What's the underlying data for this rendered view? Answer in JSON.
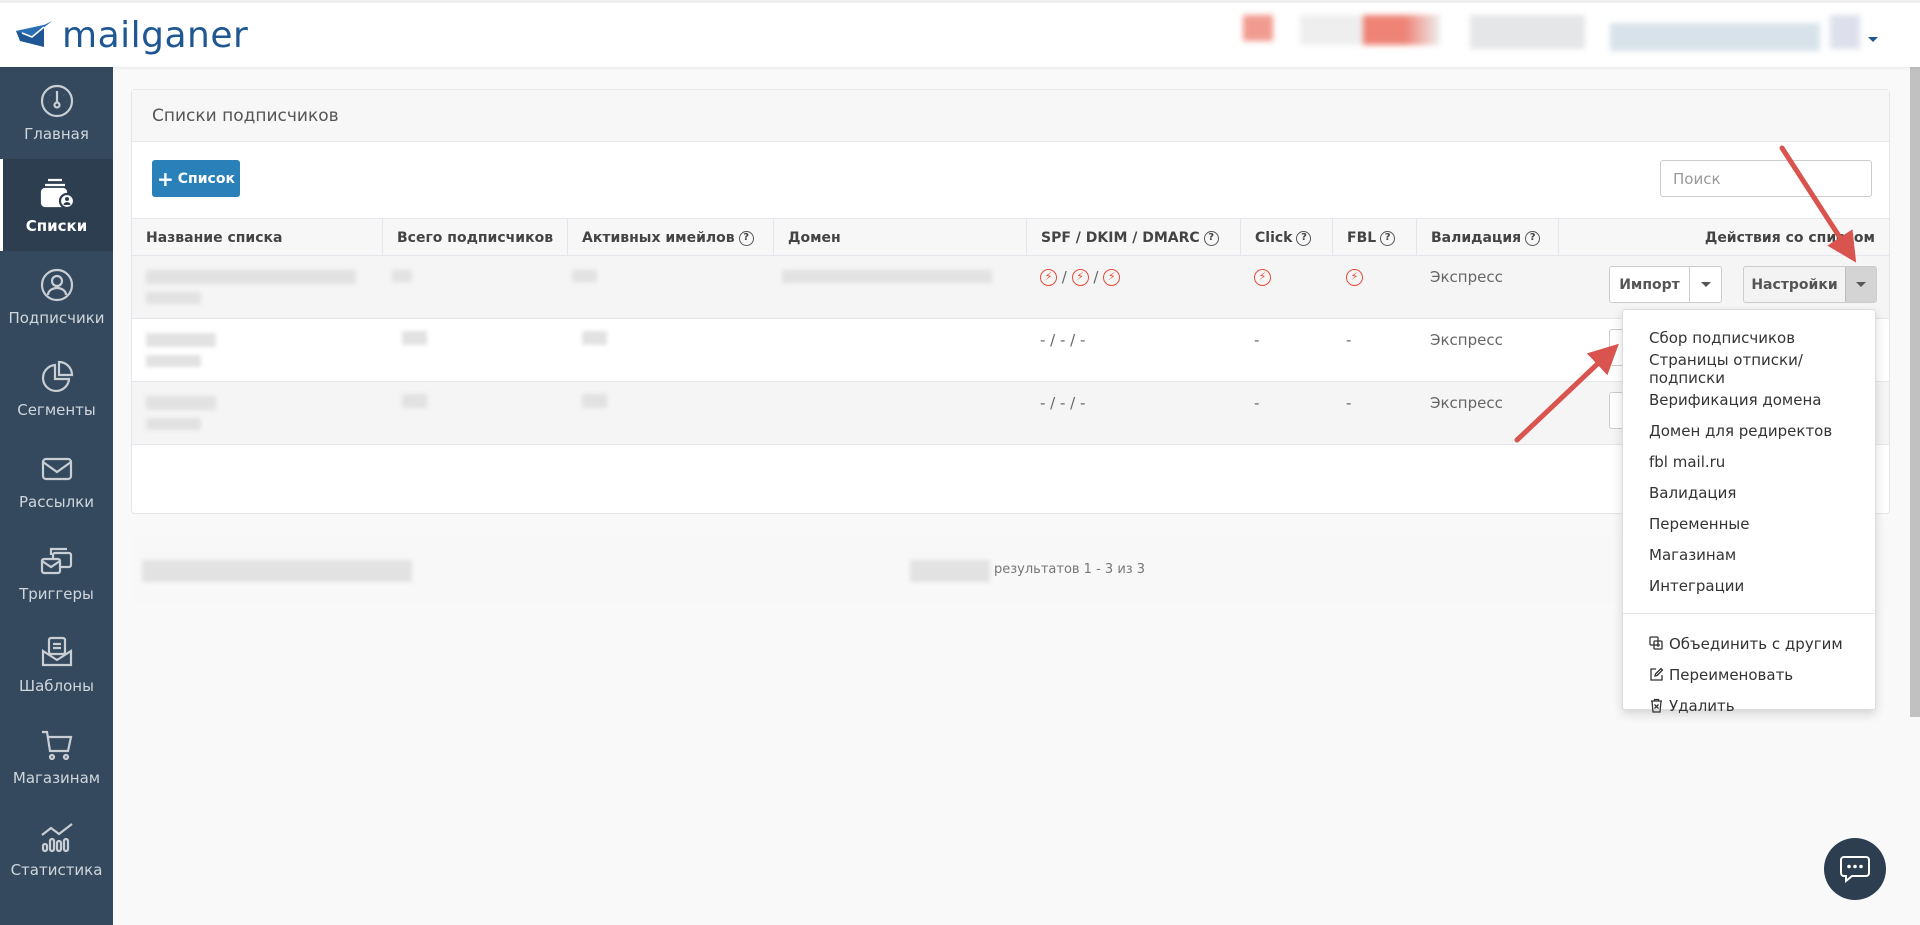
{
  "app": {
    "logo_text": "mailganer"
  },
  "sidebar": {
    "items": [
      {
        "label": "Главная",
        "icon": "dashboard-gauge-icon"
      },
      {
        "label": "Списки",
        "icon": "lists-icon",
        "active": true
      },
      {
        "label": "Подписчики",
        "icon": "user-circle-icon"
      },
      {
        "label": "Сегменты",
        "icon": "pie-chart-icon"
      },
      {
        "label": "Рассылки",
        "icon": "envelope-icon"
      },
      {
        "label": "Триггеры",
        "icon": "trigger-envelopes-icon"
      },
      {
        "label": "Шаблоны",
        "icon": "template-icon"
      },
      {
        "label": "Магазинам",
        "icon": "cart-icon"
      },
      {
        "label": "Статистика",
        "icon": "statistics-icon"
      }
    ]
  },
  "panel": {
    "title": "Списки подписчиков",
    "add_button": "Список",
    "search_placeholder": "Поиск",
    "columns": [
      "Название списка",
      "Всего подписчиков",
      "Активных имейлов",
      "Домен",
      "SPF / DKIM / DMARC",
      "Click",
      "FBL",
      "Валидация",
      "Действия со списком"
    ],
    "rows": [
      {
        "spf": "error",
        "click": "error",
        "fbl": "error",
        "validation": "Экспресс"
      },
      {
        "spf": "- / - / -",
        "click": "-",
        "fbl": "-",
        "validation": "Экспресс"
      },
      {
        "spf": "- / - / -",
        "click": "-",
        "fbl": "-",
        "validation": "Экспресс"
      }
    ],
    "import_button": "Импорт",
    "settings_button": "Настройки",
    "pagination": "результатов 1 - 3 из 3"
  },
  "dropdown": {
    "items": [
      "Сбор подписчиков",
      "Страницы отписки/подписки",
      "Верификация домена",
      "Домен для редиректов",
      "fbl mail.ru",
      "Валидация",
      "Переменные",
      "Магазинам",
      "Интеграции"
    ],
    "actions": [
      {
        "label": "Объединить с другим",
        "icon": "merge-icon"
      },
      {
        "label": "Переименовать",
        "icon": "edit-icon"
      },
      {
        "label": "Удалить",
        "icon": "trash-icon"
      }
    ]
  },
  "colors": {
    "primary": "#2a80b9",
    "sidebar": "#34495e",
    "error": "#e74c3c",
    "annotation": "#d9534f"
  }
}
